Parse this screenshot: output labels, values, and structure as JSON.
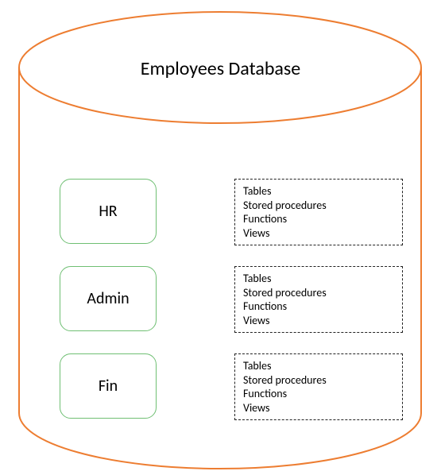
{
  "title": "Employees Database",
  "schemas": [
    {
      "name": "HR"
    },
    {
      "name": "Admin"
    },
    {
      "name": "Fin"
    }
  ],
  "objects": [
    "Tables",
    "Stored procedures",
    "Functions",
    "Views"
  ]
}
